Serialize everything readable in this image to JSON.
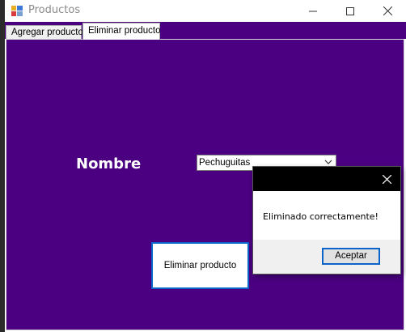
{
  "window": {
    "title": "Productos",
    "background_color": "#4b0082"
  },
  "tabs": [
    {
      "label": "Agregar producto",
      "selected": false
    },
    {
      "label": "Eliminar producto",
      "selected": true
    }
  ],
  "form": {
    "nombre_label": "Nombre",
    "product_select_value": "Pechuguitas",
    "delete_button_label": "Eliminar producto"
  },
  "dialog": {
    "message": "Eliminado correctamente!",
    "ok_label": "Aceptar"
  },
  "icons": {
    "app": "app-icon",
    "minimize": "minimize-icon",
    "maximize": "maximize-icon",
    "close": "close-icon",
    "dropdown": "chevron-down-icon"
  }
}
